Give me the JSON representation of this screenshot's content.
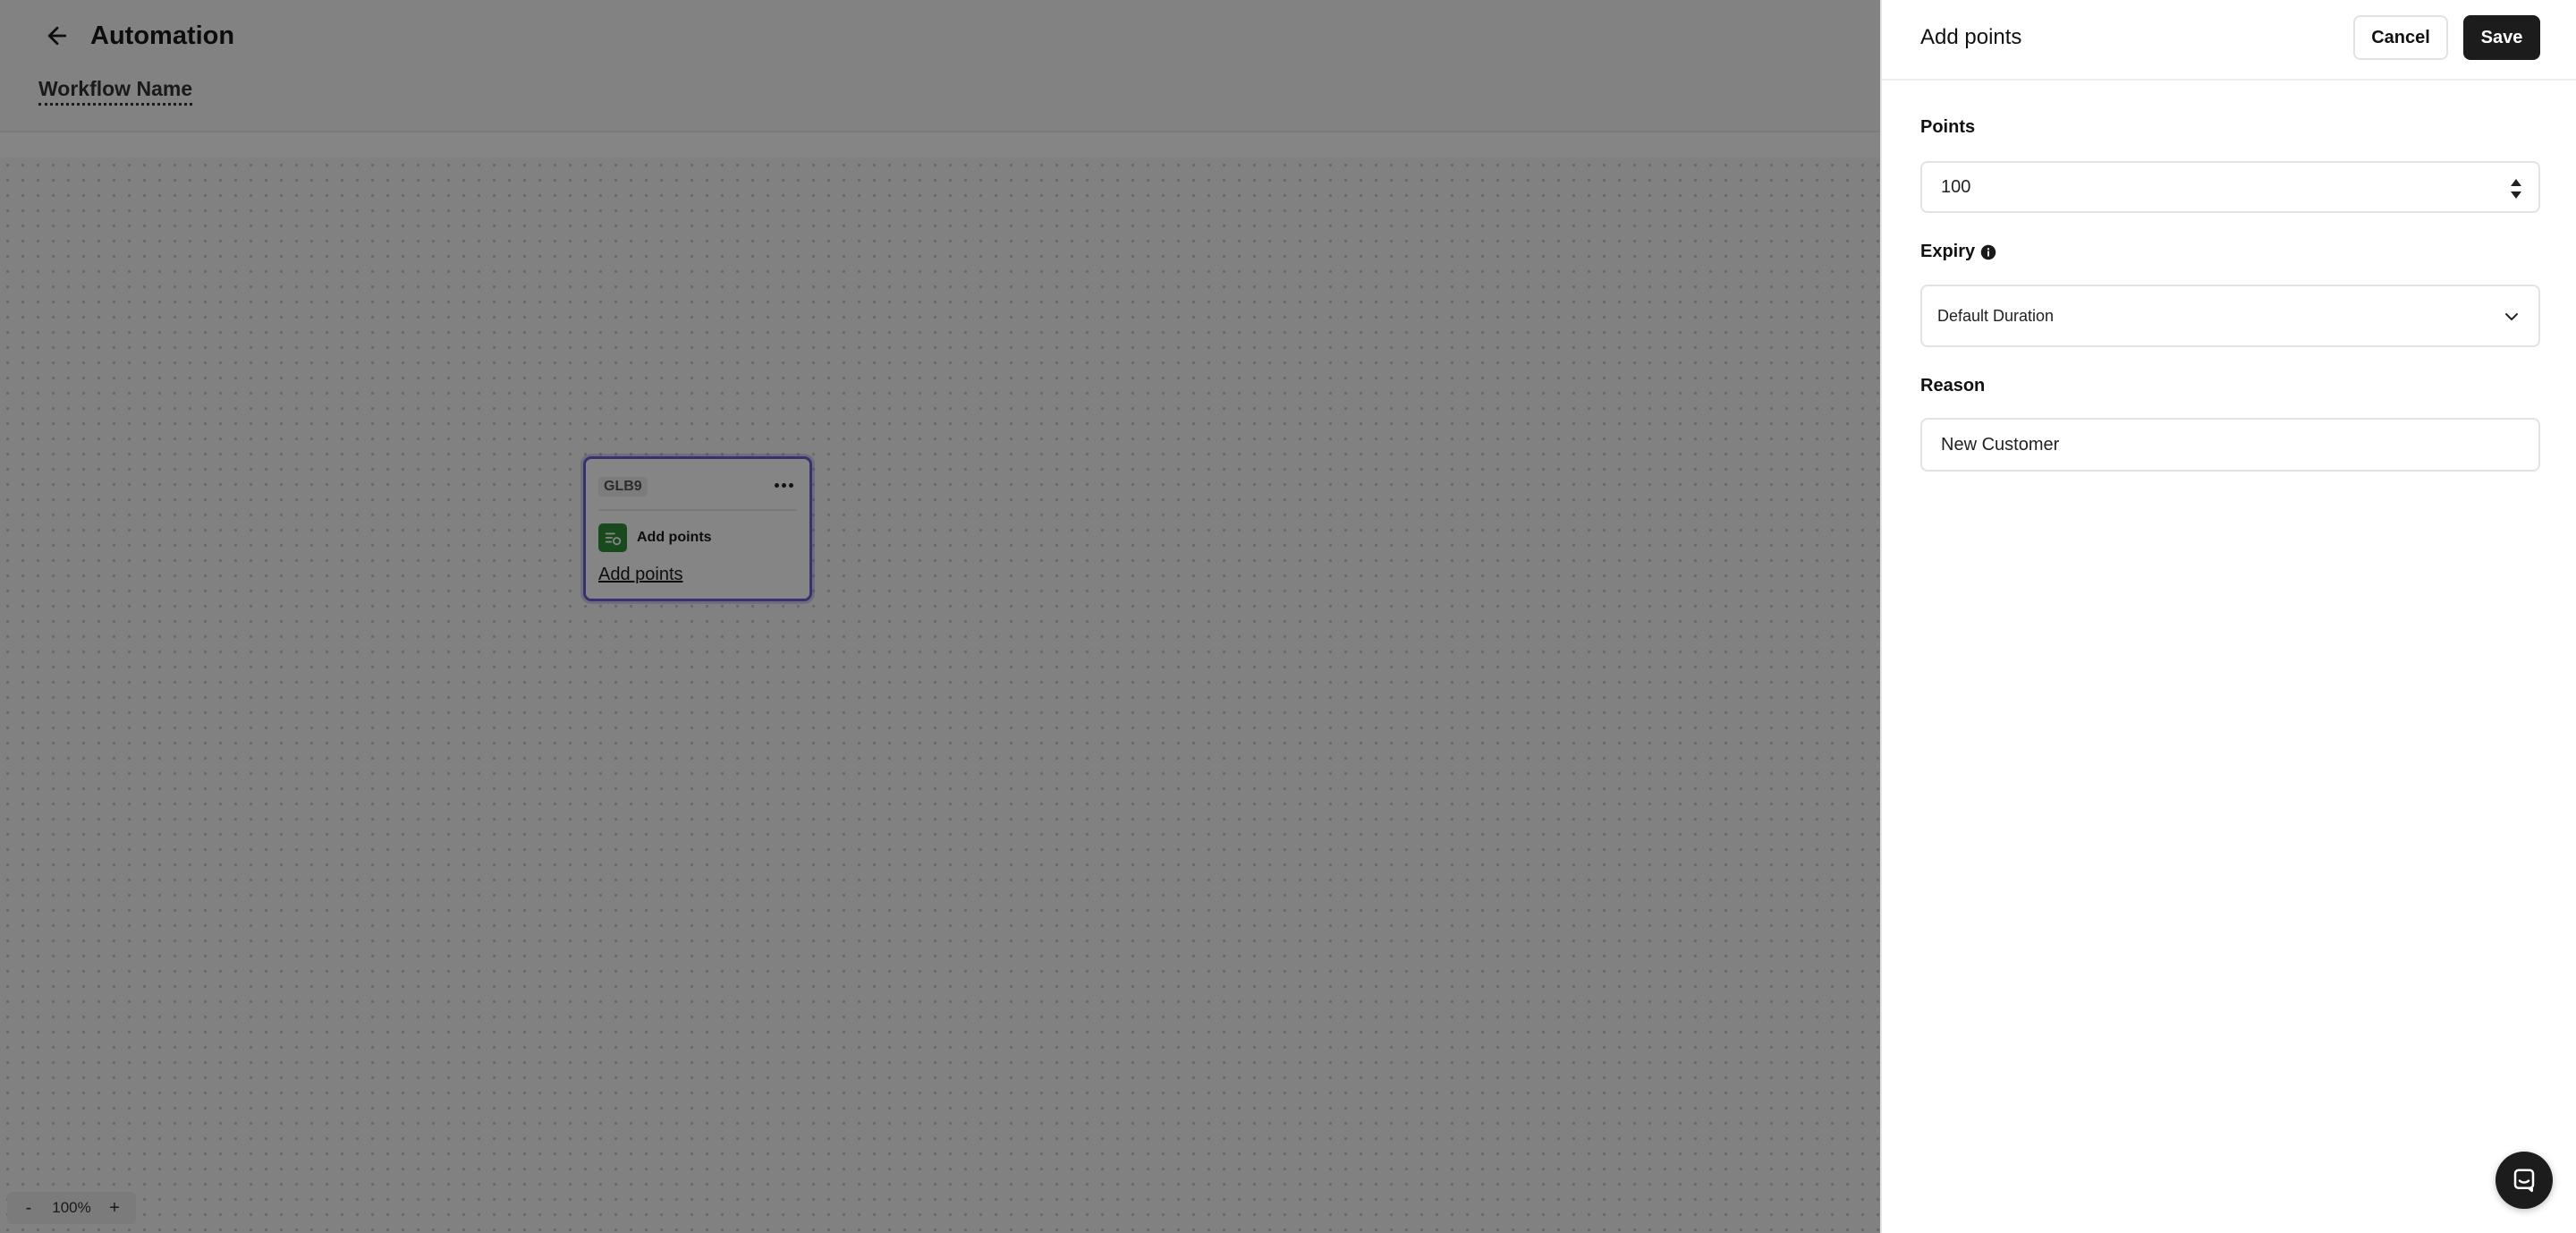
{
  "app": {
    "title": "Automation",
    "workflow_name": "Workflow Name"
  },
  "canvas": {
    "node": {
      "id": "GLB9",
      "action_label": "Add points",
      "link_label": "Add points"
    },
    "zoom": {
      "minus": "-",
      "level": "100%",
      "plus": "+"
    }
  },
  "panel": {
    "title": "Add points",
    "cancel_label": "Cancel",
    "save_label": "Save",
    "points": {
      "label": "Points",
      "value": "100"
    },
    "expiry": {
      "label": "Expiry",
      "selected": "Default Duration"
    },
    "reason": {
      "label": "Reason",
      "value": "New Customer"
    }
  },
  "colors": {
    "accent": "#6b5fd6",
    "node_icon": "#2f8f3a",
    "primary_button": "#1c1c1c"
  },
  "icons": {
    "back": "arrow-left-icon",
    "node_menu": "more-horizontal-icon",
    "node_action": "points-icon",
    "info": "info-icon",
    "chevron": "chevron-down-icon",
    "stepper": "stepper-icon",
    "chat": "chat-icon"
  }
}
